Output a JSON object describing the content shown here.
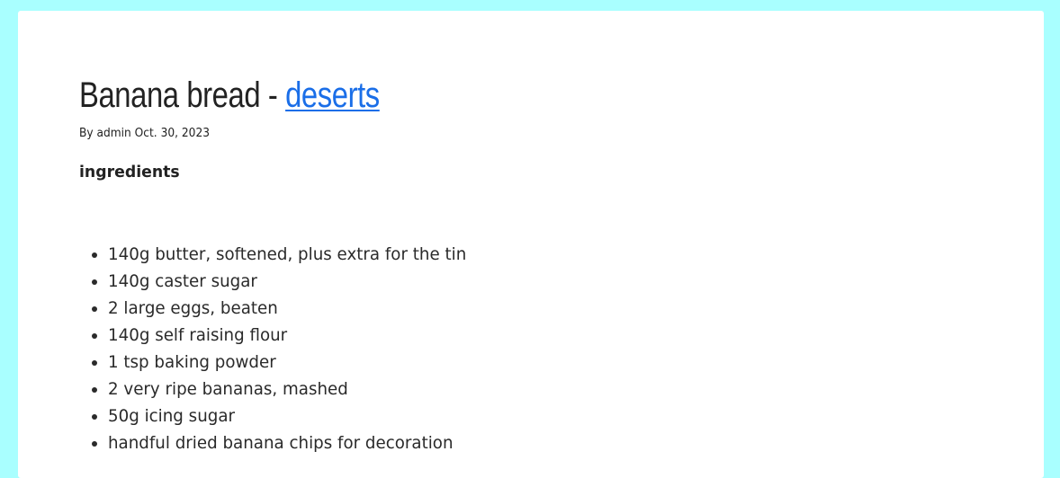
{
  "post": {
    "title": "Banana bread",
    "separator": " - ",
    "category_link": "deserts",
    "byline": "By admin Oct. 30, 2023",
    "section_heading": "ingredients",
    "ingredients": [
      "140g butter, softened, plus extra for the tin",
      "140g caster sugar",
      "2 large eggs, beaten",
      "140g self raising flour",
      "1 tsp baking powder",
      "2 very ripe bananas, mashed",
      "50g icing sugar",
      "handful dried banana chips for decoration"
    ]
  },
  "colors": {
    "page_background": "#a9ffff",
    "card_background": "#ffffff",
    "link": "#1a6ee8",
    "text": "#222222"
  }
}
